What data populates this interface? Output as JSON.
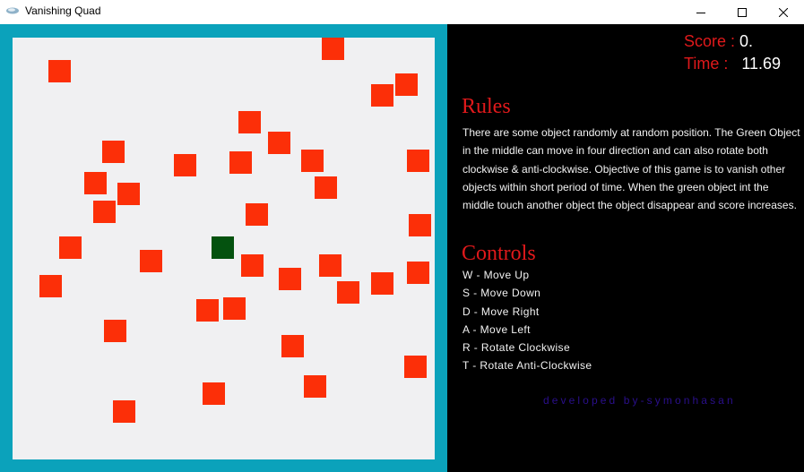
{
  "window": {
    "title": "Vanishing Quad"
  },
  "hud": {
    "score_label": "Score :",
    "score_value": "0.",
    "time_label": "Time :",
    "time_value": "11.69"
  },
  "rules": {
    "title": "Rules",
    "text": "There are some object randomly at random position. The Green Object in the middle can move in four direction and can also rotate both clockwise & anti-clockwise. Objective of this game is to vanish other objects within short period of time. When the green object int the middle touch another object the object disappear and score increases."
  },
  "controls": {
    "title": "Controls",
    "items": [
      "W - Move Up",
      "S - Move Down",
      "D - Move Right",
      "A - Move Left",
      "R - Rotate Clockwise",
      "T - Rotate Anti-Clockwise"
    ]
  },
  "credit": "developed by-symonhasan",
  "colors": {
    "board_border": "#0ba2bb",
    "board_bg": "#f0f0f2",
    "enemy": "#fc2f08",
    "player": "#04520f",
    "accent_red": "#e0191b",
    "credit": "#2a0f8c"
  }
}
